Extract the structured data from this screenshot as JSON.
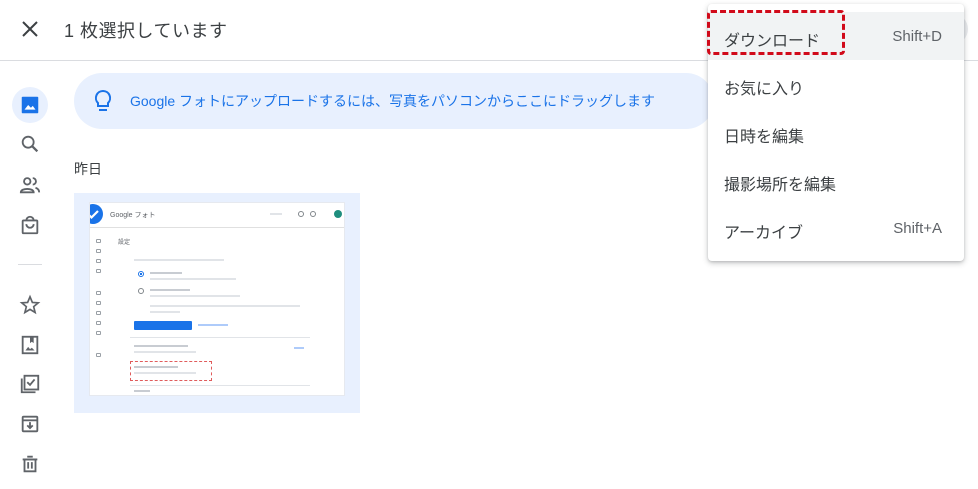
{
  "header": {
    "title": "1 枚選択しています"
  },
  "banner": {
    "text": "Google フォトにアップロードするには、写真をパソコンからここにドラッグします"
  },
  "date_group": {
    "label": "昨日"
  },
  "menu": {
    "items": [
      {
        "label": "ダウンロード",
        "shortcut": "Shift+D"
      },
      {
        "label": "お気に入り",
        "shortcut": ""
      },
      {
        "label": "日時を編集",
        "shortcut": ""
      },
      {
        "label": "撮影場所を編集",
        "shortcut": ""
      },
      {
        "label": "アーカイブ",
        "shortcut": "Shift+A"
      }
    ]
  },
  "thumbnail": {
    "app_name": "Google フォト",
    "heading": "設定"
  },
  "sidebar": {
    "icons": [
      "photos-icon",
      "search-icon",
      "people-icon",
      "shopping-bag-icon",
      "star-icon",
      "album-icon",
      "utilities-icon",
      "archive-icon",
      "trash-icon"
    ]
  },
  "colors": {
    "accent": "#1a73e8",
    "banner_bg": "#e8f0fe",
    "highlight_border": "#d10a1a"
  }
}
